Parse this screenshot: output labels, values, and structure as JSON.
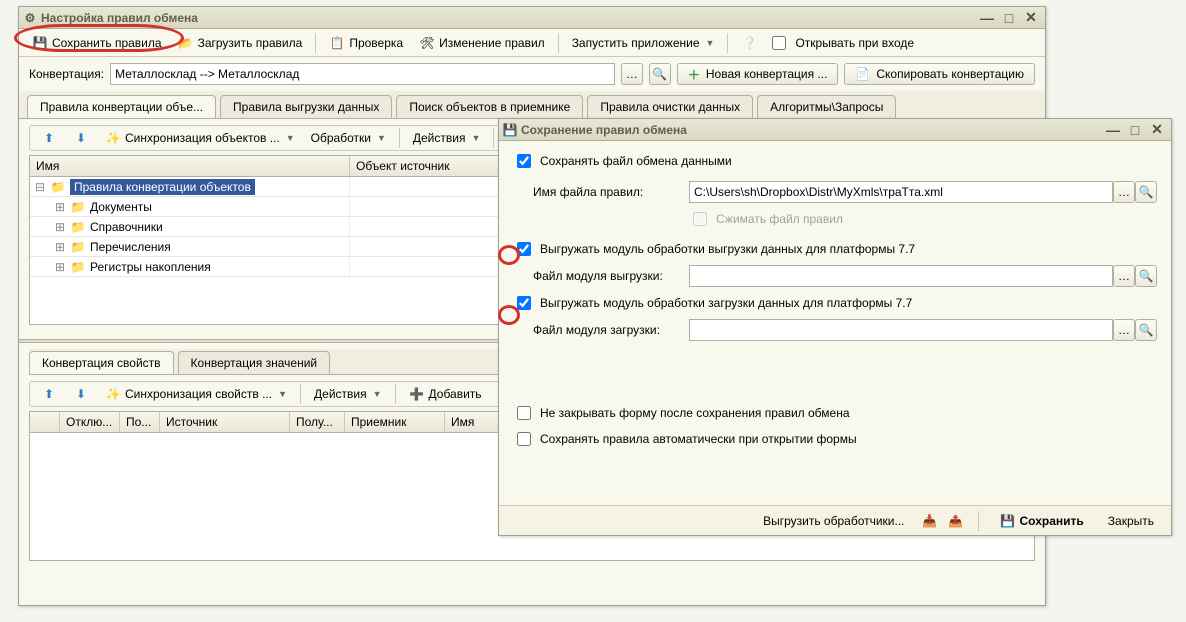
{
  "main": {
    "title": "Настройка правил обмена",
    "toolbar": {
      "save": "Сохранить правила",
      "load": "Загрузить правила",
      "check": "Проверка",
      "modify": "Изменение правил",
      "run": "Запустить приложение",
      "open_on_start": "Открывать при входе"
    },
    "conversion_label": "Конвертация:",
    "conversion_value": "Металлосклад --> Металлосклад",
    "new_conversion": "Новая конвертация ...",
    "copy_conversion": "Скопировать конвертацию",
    "tabs": [
      "Правила конвертации объе...",
      "Правила выгрузки данных",
      "Поиск объектов в приемнике",
      "Правила очистки данных",
      "Алгоритмы\\Запросы"
    ],
    "tree_toolbar": {
      "sync": "Синхронизация объектов ...",
      "proc": "Обработки",
      "actions": "Действия"
    },
    "tree_headers": {
      "name": "Имя",
      "source": "Объект источник"
    },
    "tree_rows": [
      {
        "label": "Правила конвертации объектов",
        "selected": true,
        "expanded": true
      },
      {
        "label": "Документы",
        "selected": false,
        "expanded": false
      },
      {
        "label": "Справочники",
        "selected": false,
        "expanded": false
      },
      {
        "label": "Перечисления",
        "selected": false,
        "expanded": false
      },
      {
        "label": "Регистры накопления",
        "selected": false,
        "expanded": false
      }
    ],
    "prop_tabs": [
      "Конвертация свойств",
      "Конвертация значений"
    ],
    "prop_toolbar": {
      "sync": "Синхронизация свойств ...",
      "actions": "Действия",
      "add": "Добавить"
    },
    "prop_headers": [
      "",
      "Отклю...",
      "По...",
      "Источник",
      "Полу...",
      "Приемник",
      "Имя"
    ]
  },
  "dialog": {
    "title": "Сохранение правил обмена",
    "save_exchange_file": "Сохранять файл обмена данными",
    "rules_filename_label": "Имя файла правил:",
    "rules_filename": "C:\\Users\\sh\\Dropbox\\Distr\\MyXmls\\траТта.xml",
    "compress": "Сжимать файл правил",
    "export_upload_module": "Выгружать модуль обработки выгрузки данных для платформы 7.7",
    "upload_module_label": "Файл модуля выгрузки:",
    "upload_module_value": "",
    "export_download_module": "Выгружать модуль обработки загрузки данных для платформы 7.7",
    "download_module_label": "Файл модуля загрузки:",
    "download_module_value": "",
    "dont_close": "Не закрывать форму после сохранения правил обмена",
    "auto_save": "Сохранять правила автоматически при открытии формы",
    "export_handlers": "Выгрузить обработчики...",
    "save": "Сохранить",
    "close": "Закрыть"
  }
}
